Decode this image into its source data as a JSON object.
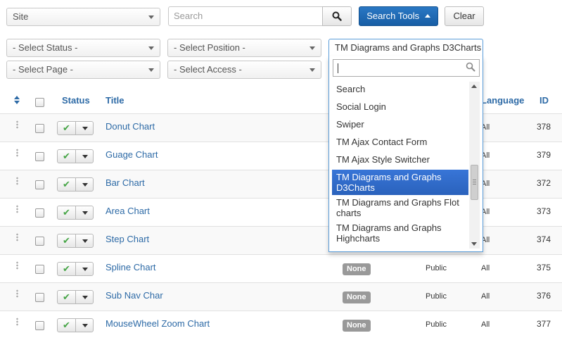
{
  "filters": {
    "client_select": "Site",
    "search_placeholder": "Search",
    "search_tools_label": "Search Tools",
    "clear_label": "Clear",
    "status_select": "- Select Status -",
    "position_select": "- Select Position -",
    "page_select": "- Select Page -",
    "access_select": "- Select Access -"
  },
  "type_dropdown": {
    "selected": "TM Diagrams and Graphs D3Charts",
    "options": [
      "Search",
      "Social Login",
      "Swiper",
      "TM Ajax Contact Form",
      "TM Ajax Style Switcher",
      "TM Diagrams and Graphs D3Charts",
      "TM Diagrams and Graphs Flot charts",
      "TM Diagrams and Graphs Highcharts"
    ],
    "selected_index": 5
  },
  "table": {
    "headers": {
      "status": "Status",
      "title": "Title",
      "language": "Language",
      "id": "ID"
    },
    "rows": [
      {
        "title": "Donut Chart",
        "pages": "",
        "access": "",
        "language": "All",
        "id": "378"
      },
      {
        "title": "Guage Chart",
        "pages": "",
        "access": "",
        "language": "All",
        "id": "379"
      },
      {
        "title": "Bar Chart",
        "pages": "",
        "access": "",
        "language": "All",
        "id": "372"
      },
      {
        "title": "Area Chart",
        "pages": "",
        "access": "",
        "language": "All",
        "id": "373"
      },
      {
        "title": "Step Chart",
        "pages": "",
        "access": "",
        "language": "All",
        "id": "374"
      },
      {
        "title": "Spline Chart",
        "pages": "None",
        "access": "Public",
        "language": "All",
        "id": "375"
      },
      {
        "title": "Sub Nav Char",
        "pages": "None",
        "access": "Public",
        "language": "All",
        "id": "376"
      },
      {
        "title": "MouseWheel Zoom Chart",
        "pages": "None",
        "access": "Public",
        "language": "All",
        "id": "377"
      }
    ]
  },
  "colors": {
    "link": "#2d6aa6",
    "primary_button": "#1f6cb6",
    "selected_option": "#3875d7",
    "published": "#46a546",
    "badge": "#999999"
  }
}
